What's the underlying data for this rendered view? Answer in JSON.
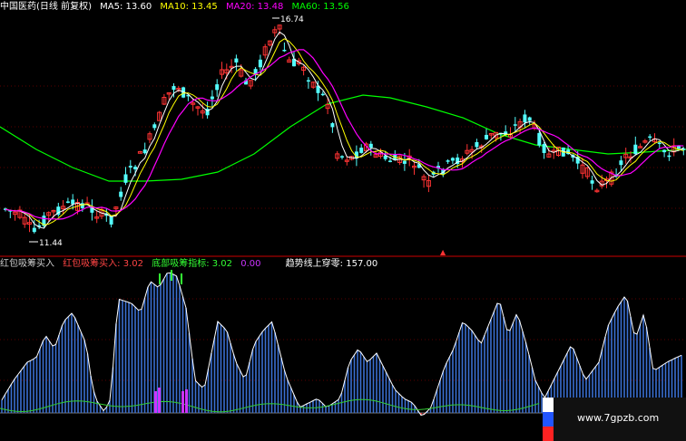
{
  "top_legend": {
    "title": "中国医药(日线 前复权)",
    "ma5": "MA5: 13.60",
    "ma10": "MA10: 13.45",
    "ma20": "MA20: 13.48",
    "ma60": "MA60: 13.56"
  },
  "annotations": {
    "high": "16.74",
    "low": "11.44"
  },
  "bottom_legend": {
    "name": "红包吸筹买入",
    "item1": "红包吸筹买入: 3.02",
    "item2": "底部吸筹指标: 3.02",
    "item3": "0.00",
    "item4": "趋势线上穿零: 157.00"
  },
  "watermark": {
    "text": "www.7gpzb.com"
  },
  "colors": {
    "ma5": "#ffffff",
    "ma10": "#ffff00",
    "ma20": "#ff00ff",
    "ma60": "#00ff00",
    "up": "#ff3333",
    "down": "#54ffff",
    "bar": "#3a6fd0",
    "divider": "#cc0000"
  },
  "chart_data": [
    {
      "type": "candlestick",
      "title": "中国医药(日线 前复权)",
      "series": [
        {
          "name": "MA5",
          "value": 13.6
        },
        {
          "name": "MA10",
          "value": 13.45
        },
        {
          "name": "MA20",
          "value": 13.48
        },
        {
          "name": "MA60",
          "value": 13.56
        }
      ],
      "max_price": 16.74,
      "min_price": 11.44
    },
    {
      "type": "bar",
      "series": [
        {
          "name": "红包吸筹买入",
          "value": 3.02
        },
        {
          "name": "底部吸筹指标",
          "value": 3.02
        },
        {
          "name": "趋势线上穿零",
          "value": 157.0
        }
      ]
    }
  ]
}
